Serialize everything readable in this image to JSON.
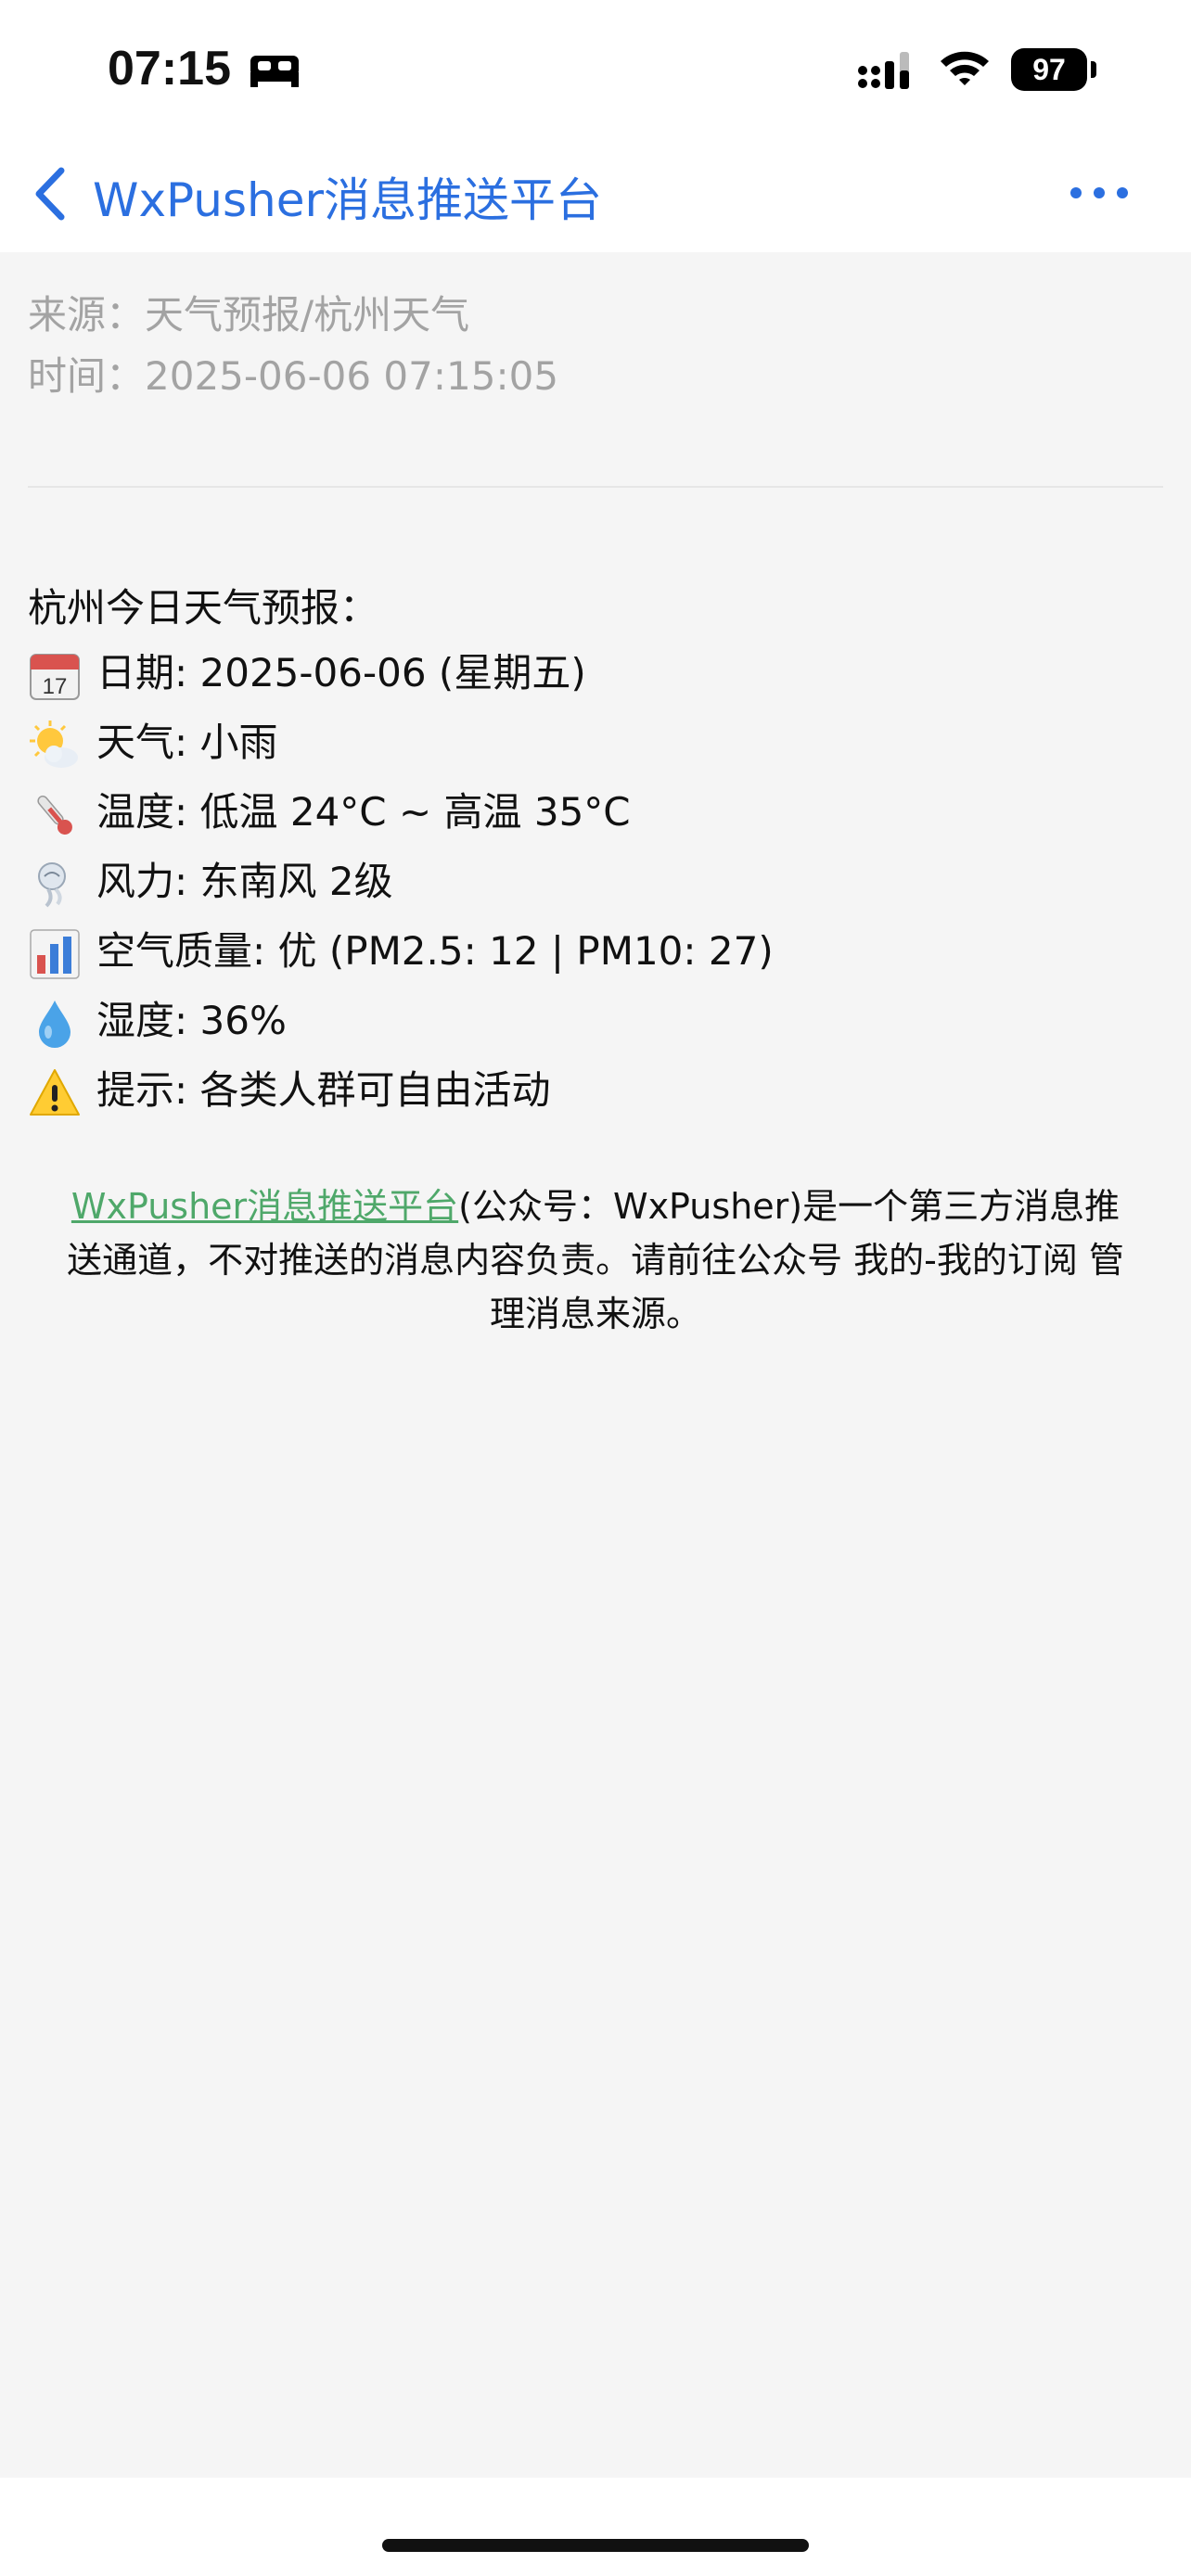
{
  "status_bar": {
    "time": "07:15",
    "battery": "97",
    "icons": [
      "sleep-icon",
      "signal-icon",
      "wifi-icon",
      "battery-icon"
    ]
  },
  "nav": {
    "title": "WxPusher消息推送平台",
    "back_icon": "chevron-left-icon",
    "more_icon": "more-horizontal-icon",
    "accent_color": "#2b6fe0"
  },
  "meta": {
    "source": "来源：天气预报/杭州天气",
    "time": "时间：2025-06-06 07:15:05"
  },
  "content": {
    "heading": "杭州今日天气预报：",
    "lines": [
      {
        "icon": "calendar-icon",
        "text": "日期: 2025-06-06 (星期五)"
      },
      {
        "icon": "sun-cloud-icon",
        "text": "天气: 小雨"
      },
      {
        "icon": "thermometer-icon",
        "text": "温度: 低温 24°C ~ 高温 35°C"
      },
      {
        "icon": "wind-icon",
        "text": "风力: 东南风 2级"
      },
      {
        "icon": "bar-chart-icon",
        "text": "空气质量: 优 (PM2.5: 12 | PM10: 27)"
      },
      {
        "icon": "droplet-icon",
        "text": "湿度: 36%"
      },
      {
        "icon": "warning-icon",
        "text": "提示: 各类人群可自由活动"
      }
    ]
  },
  "footer": {
    "link": "WxPusher消息推送平台",
    "text": "(公众号：WxPusher)是一个第三方消息推送通道，不对推送的消息内容负责。请前往公众号 我的-我的订阅 管理消息来源。",
    "link_color": "#4fa86a"
  }
}
